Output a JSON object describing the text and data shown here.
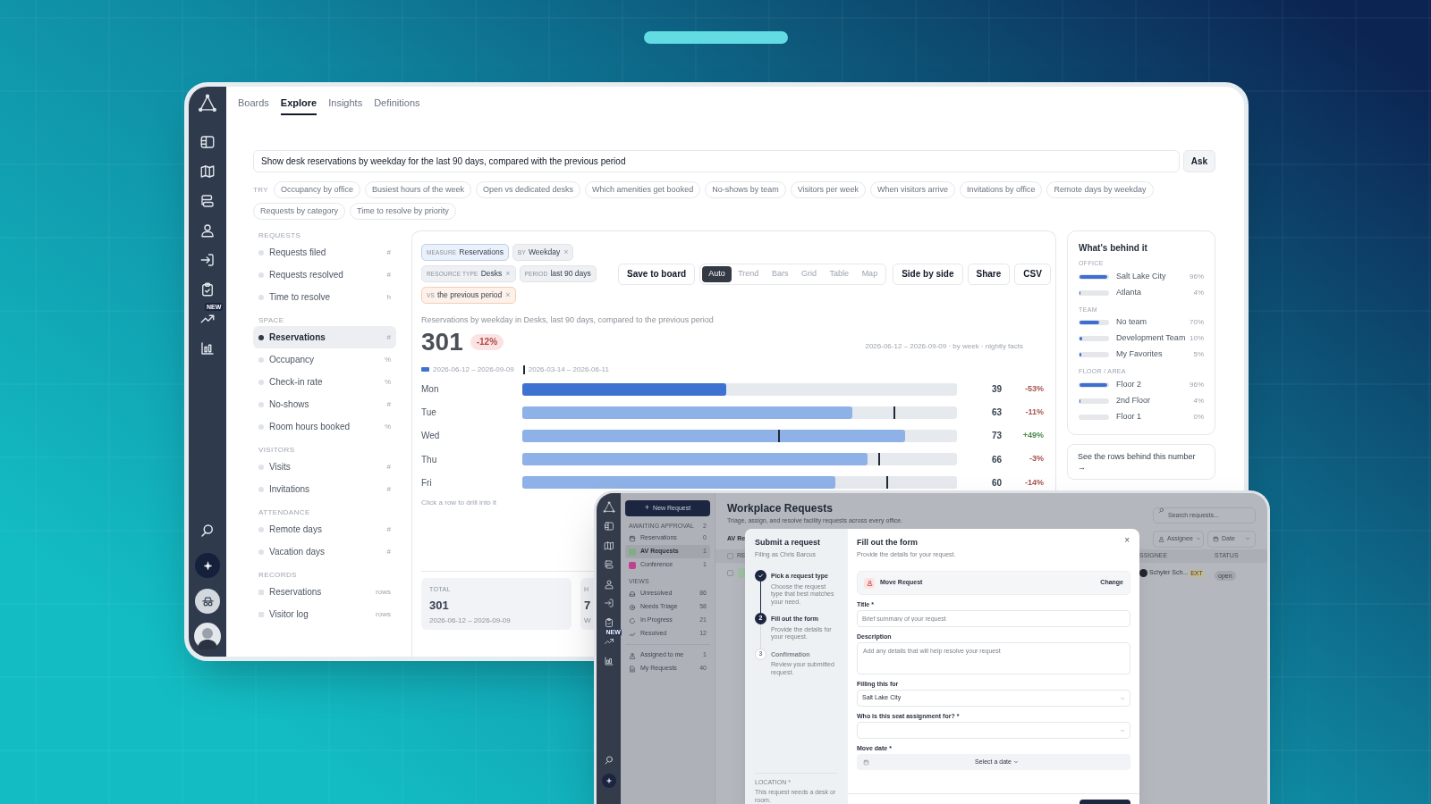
{
  "explore_window": {
    "sidebar": {
      "new_badge": "NEW"
    },
    "tabs": [
      {
        "label": "Boards",
        "selected": false
      },
      {
        "label": "Explore",
        "selected": true
      },
      {
        "label": "Insights",
        "selected": false
      },
      {
        "label": "Definitions",
        "selected": false
      }
    ],
    "query": {
      "value": "Show desk reservations by weekday for the last 90 days, compared with the previous period",
      "button": "Ask"
    },
    "suggestions": {
      "label": "TRY",
      "chips": [
        "Occupancy by office",
        "Busiest hours of the week",
        "Open vs dedicated desks",
        "Which amenities get booked",
        "No-shows by team",
        "Visitors per week",
        "When visitors arrive",
        "Invitations by office",
        "Remote days by weekday",
        "Requests by category",
        "Time to resolve by priority"
      ]
    },
    "metrics_nav": [
      {
        "title": "REQUESTS",
        "kind": "metric",
        "items": [
          {
            "label": "Requests filed",
            "unit": "#",
            "selected": false
          },
          {
            "label": "Requests resolved",
            "unit": "#",
            "selected": false
          },
          {
            "label": "Time to resolve",
            "unit": "h",
            "selected": false
          }
        ]
      },
      {
        "title": "SPACE",
        "kind": "metric",
        "items": [
          {
            "label": "Reservations",
            "unit": "#",
            "selected": true
          },
          {
            "label": "Occupancy",
            "unit": "%",
            "selected": false
          },
          {
            "label": "Check-in rate",
            "unit": "%",
            "selected": false
          },
          {
            "label": "No-shows",
            "unit": "#",
            "selected": false
          },
          {
            "label": "Room hours booked",
            "unit": "%",
            "selected": false
          }
        ]
      },
      {
        "title": "VISITORS",
        "kind": "metric",
        "items": [
          {
            "label": "Visits",
            "unit": "#",
            "selected": false
          },
          {
            "label": "Invitations",
            "unit": "#",
            "selected": false
          }
        ]
      },
      {
        "title": "ATTENDANCE",
        "kind": "metric",
        "items": [
          {
            "label": "Remote days",
            "unit": "#",
            "selected": false
          },
          {
            "label": "Vacation days",
            "unit": "#",
            "selected": false
          }
        ]
      },
      {
        "title": "RECORDS",
        "kind": "record",
        "items": [
          {
            "label": "Reservations",
            "unit": "rows",
            "selected": false
          },
          {
            "label": "Visitor log",
            "unit": "rows",
            "selected": false
          }
        ]
      }
    ],
    "query_chips": [
      {
        "kind": "measure",
        "key": "MEASURE",
        "value": "Reservations"
      },
      {
        "kind": "filter",
        "key": "BY",
        "value": "Weekday",
        "remove": "×"
      },
      {
        "kind": "filter",
        "key": "RESOURCE TYPE",
        "value": "Desks",
        "remove": "×"
      },
      {
        "kind": "filter",
        "key": "PERIOD",
        "value": "last 90 days"
      },
      {
        "kind": "compare",
        "key": "VS",
        "value": "the previous period",
        "remove": "×"
      }
    ],
    "actions": {
      "save": "Save to board",
      "views": [
        {
          "label": "Auto",
          "selected": true
        },
        {
          "label": "Trend",
          "selected": false
        },
        {
          "label": "Bars",
          "selected": false
        },
        {
          "label": "Grid",
          "selected": false
        },
        {
          "label": "Table",
          "selected": false
        },
        {
          "label": "Map",
          "selected": false
        }
      ],
      "buttons": [
        "Side by side",
        "Share",
        "CSV"
      ]
    },
    "summary": {
      "caption": "Reservations by weekday in Desks, last 90 days, compared to the previous period",
      "total": "301",
      "change": "-12%",
      "meta": "2026-06-12 – 2026-09-09 · by week · nightly facts"
    },
    "chart": {
      "legend": [
        {
          "kind": "current",
          "label": "2026-06-12 – 2026-09-09"
        },
        {
          "kind": "prior",
          "label": "2026-03-14 – 2026-06-11"
        }
      ],
      "rows": [
        {
          "label": "Mon",
          "value": "39",
          "change": "-53%",
          "color": "#a85450",
          "selected": true,
          "level": 0.47
        },
        {
          "label": "Tue",
          "value": "63",
          "change": "-11%",
          "color": "#a85450",
          "selected": false,
          "level": 0.76,
          "prior": {
            "level": 0.855
          }
        },
        {
          "label": "Wed",
          "value": "73",
          "change": "+49%",
          "color": "#4e8a52",
          "selected": false,
          "level": 0.88,
          "prior": {
            "level": 0.59
          }
        },
        {
          "label": "Thu",
          "value": "66",
          "change": "-3%",
          "color": "#a85450",
          "selected": false,
          "level": 0.795,
          "prior": {
            "level": 0.82
          }
        },
        {
          "label": "Fri",
          "value": "60",
          "change": "-14%",
          "color": "#a85450",
          "selected": false,
          "level": 0.72,
          "prior": {
            "level": 0.84
          }
        }
      ],
      "hint": "Click a row to drill into it"
    },
    "totals": [
      {
        "label": "TOTAL",
        "value": "301",
        "range": "2026-06-12 – 2026-09-09"
      },
      {
        "label": "H",
        "value": "7",
        "range": "W"
      }
    ],
    "breakdown": {
      "title": "What's behind it",
      "groups": [
        {
          "title": "OFFICE",
          "rows": [
            {
              "label": "Salt Lake City",
              "share": "96%",
              "level": 0.96
            },
            {
              "label": "Atlanta",
              "share": "4%",
              "level": 0.04
            }
          ]
        },
        {
          "title": "TEAM",
          "rows": [
            {
              "label": "No team",
              "share": "70%",
              "level": 0.7
            },
            {
              "label": "Development Team",
              "share": "10%",
              "level": 0.1
            },
            {
              "label": "My Favorites",
              "share": "5%",
              "level": 0.05
            }
          ]
        },
        {
          "title": "FLOOR / AREA",
          "rows": [
            {
              "label": "Floor 2",
              "share": "96%",
              "level": 0.96
            },
            {
              "label": "2nd Floor",
              "share": "4%",
              "level": 0.04
            },
            {
              "label": "Floor 1",
              "share": "0%"
            }
          ]
        }
      ],
      "link": "See the rows behind this number →"
    }
  },
  "requests_window": {
    "sidebar": {
      "new_badge": "NEW"
    },
    "new_button": {
      "icon": "+",
      "label": "New Request"
    },
    "nav": [
      {
        "title": "AWAITING APPROVAL",
        "count": "2",
        "items": [
          {
            "label": "Reservations",
            "count": "0",
            "selected": false
          },
          {
            "label": "AV Requests",
            "count": "1",
            "selected": true,
            "color": "#7fae86"
          },
          {
            "label": "Conference",
            "count": "1",
            "selected": false,
            "color": "#c2418f"
          }
        ]
      },
      {
        "title": "VIEWS",
        "items": [
          {
            "label": "Unresolved",
            "count": "86",
            "selected": false
          },
          {
            "label": "Needs Triage",
            "count": "58",
            "selected": false
          },
          {
            "label": "In Progress",
            "count": "21",
            "selected": false
          },
          {
            "label": "Resolved",
            "count": "12",
            "selected": false
          }
        ]
      },
      {
        "items": [
          {
            "label": "Assigned to me",
            "count": "1",
            "selected": false
          },
          {
            "label": "My Requests",
            "count": "40",
            "selected": false
          }
        ]
      }
    ],
    "title": "Workplace Requests",
    "subtitle": "Triage, assign, and resolve facility requests across every office.",
    "search": {
      "placeholder": "Search requests..."
    },
    "view_title": "AV Re",
    "filters": [
      "Assignee",
      "Date"
    ],
    "columns": [
      "RE",
      "SSIGNEE",
      "STATUS"
    ],
    "select_all": {
      "checked": false
    },
    "row": {
      "checked": false,
      "assignee": "Schyler Sch...",
      "badge": "EXT",
      "status": "open"
    },
    "modal": {
      "steps_title": "Submit a request",
      "filing_as": "Filing as Chris Barcus",
      "steps": [
        {
          "done": true,
          "active": false,
          "title": "Pick a request type",
          "text": "Choose the request type that best matches your need."
        },
        {
          "done": false,
          "active": true,
          "number": "2",
          "title": "Fill out the form",
          "text": "Provide the details for your request."
        },
        {
          "done": false,
          "active": false,
          "number": "3",
          "title": "Confirmation",
          "text": "Review your submitted request."
        }
      ],
      "location": {
        "label": "LOCATION *",
        "text": "This request needs a desk or room."
      },
      "title": "Fill out the form",
      "subtitle": "Provide the details for your request.",
      "close": "×",
      "request_type": {
        "label": "Move Request",
        "action": "Change"
      },
      "fields": [
        {
          "kind": "text",
          "label": "Title *",
          "placeholder": "Brief summary of your request"
        },
        {
          "kind": "textarea",
          "label": "Description",
          "placeholder": "Add any details that will help resolve your request"
        },
        {
          "kind": "select",
          "label": "Filling this for",
          "value": "Salt Lake City"
        },
        {
          "kind": "select",
          "label": "Who is this seat assignment for? *"
        },
        {
          "kind": "date",
          "label": "Move date *",
          "value": "Select a date"
        }
      ]
    }
  }
}
